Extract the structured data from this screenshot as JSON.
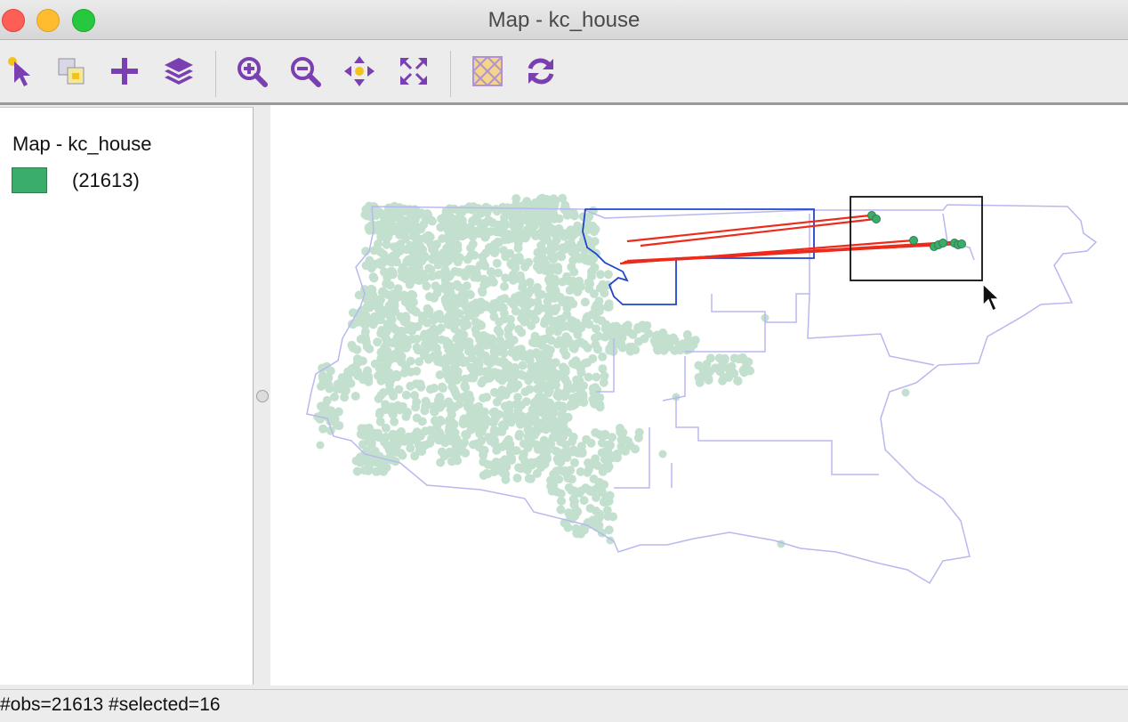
{
  "window": {
    "title": "Map - kc_house"
  },
  "toolbar": {
    "buttons": [
      {
        "name": "select-tool",
        "icon": "pointer-select-icon"
      },
      {
        "name": "selection-shape",
        "icon": "selection-shape-icon"
      },
      {
        "name": "add-layer",
        "icon": "plus-icon"
      },
      {
        "name": "layers",
        "icon": "layers-icon"
      },
      {
        "name": "zoom-in",
        "icon": "zoom-in-icon"
      },
      {
        "name": "zoom-out",
        "icon": "zoom-out-icon"
      },
      {
        "name": "pan",
        "icon": "pan-icon"
      },
      {
        "name": "full-extent",
        "icon": "full-extent-icon"
      },
      {
        "name": "basemap",
        "icon": "basemap-icon"
      },
      {
        "name": "refresh",
        "icon": "refresh-icon"
      }
    ]
  },
  "legend": {
    "title": "Map - kc_house",
    "items": [
      {
        "label": "(21613)",
        "color": "#3aad6a"
      }
    ]
  },
  "status": {
    "text": "#obs=21613 #selected=16"
  },
  "colors": {
    "accent": "#7a3fb0",
    "point_unselected": "#c3e0cf",
    "point_selected": "#3aad6a",
    "boundary": "#b8b8f0",
    "selected_boundary": "#2244cc",
    "link_line": "#ee2a1a"
  }
}
